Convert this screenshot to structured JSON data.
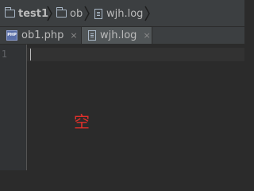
{
  "breadcrumb": {
    "items": [
      "test1",
      "ob",
      "wjh.log"
    ]
  },
  "tabs": [
    {
      "label": "ob1.php",
      "icon": "php-file-icon",
      "close": "×",
      "active": false
    },
    {
      "label": "wjh.log",
      "icon": "text-file-icon",
      "close": "×",
      "active": true
    }
  ],
  "editor": {
    "line_numbers": [
      "1"
    ],
    "content": ""
  },
  "annotation": {
    "text": "空",
    "color": "#e0302a"
  },
  "colors": {
    "background": "#2b2b2b",
    "toolbar": "#3c3f41",
    "active_tab": "#515658",
    "gutter": "#313335"
  }
}
